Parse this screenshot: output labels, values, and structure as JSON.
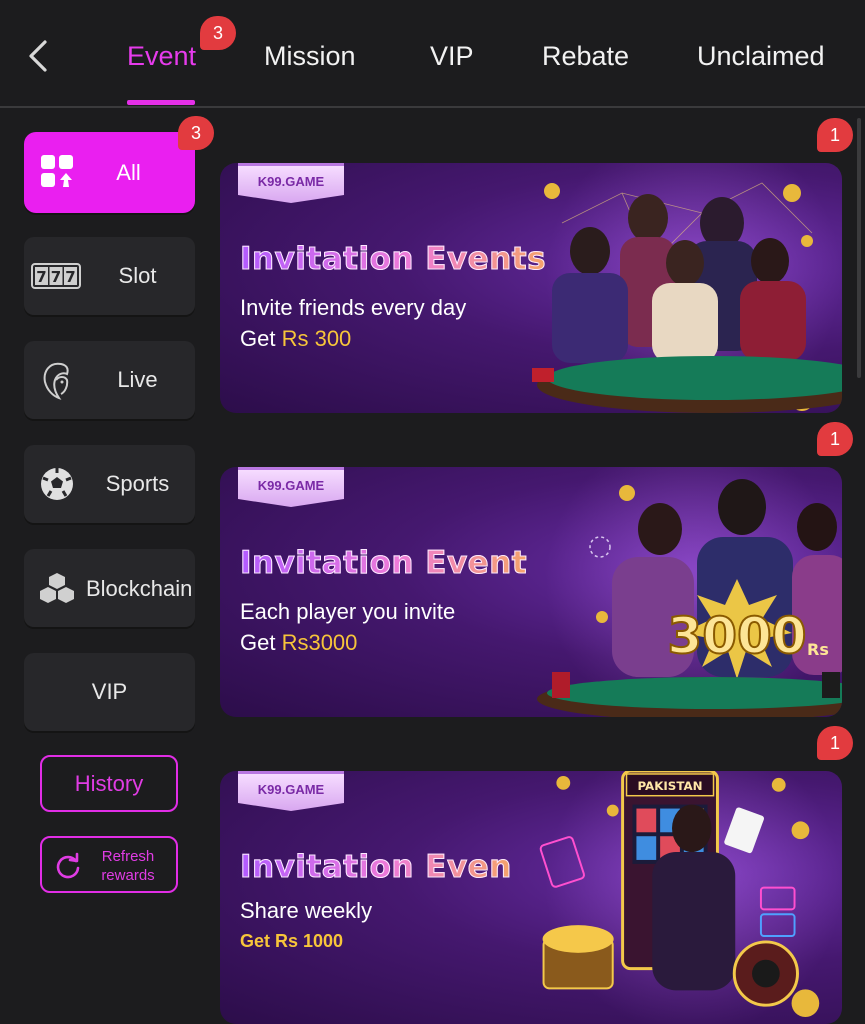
{
  "nav": {
    "tabs": [
      {
        "label": "Event",
        "badge": "3"
      },
      {
        "label": "Mission"
      },
      {
        "label": "VIP"
      },
      {
        "label": "Rebate"
      },
      {
        "label": "Unclaimed"
      }
    ],
    "active_tab": "Event"
  },
  "sidebar": {
    "items": [
      {
        "label": "All",
        "icon": "grid-apps-icon",
        "badge": "3",
        "active": true
      },
      {
        "label": "Slot",
        "icon": "slot-777-icon"
      },
      {
        "label": "Live",
        "icon": "live-dealer-icon"
      },
      {
        "label": "Sports",
        "icon": "soccer-ball-icon"
      },
      {
        "label": "Blockchain",
        "icon": "blockchain-cubes-icon"
      },
      {
        "label": "VIP"
      }
    ],
    "history_label": "History",
    "refresh_label": "Refresh rewards"
  },
  "events": [
    {
      "brand": "K99.GAME",
      "title": "Invitation Events",
      "subtitle": "Invite friends every day",
      "get_prefix": "Get ",
      "amount": "Rs 300",
      "badge": "1"
    },
    {
      "brand": "K99.GAME",
      "title": "Invitation Event",
      "subtitle": "Each player you invite",
      "get_prefix": "Get ",
      "amount": "Rs3000",
      "badge": "1",
      "art_text": "3000",
      "art_unit": "Rs"
    },
    {
      "brand": "K99.GAME",
      "title": "Invitation Even",
      "subtitle": "Share weekly",
      "get_prefix": "Get Rs 1000",
      "amount": "",
      "badge": "1",
      "art_sign": "PAKISTAN"
    }
  ],
  "colors": {
    "accent": "#ea1ff0",
    "badge": "#e23b3f",
    "background": "#1c1c1e",
    "gold": "#f7c53a"
  }
}
